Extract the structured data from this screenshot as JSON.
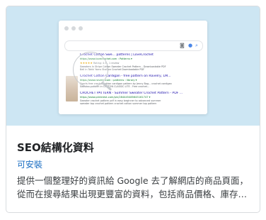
{
  "card": {
    "title": "SEO結構化資料",
    "tag": "可安裝",
    "description": "提供一個整理好的資訊給 Google 去了解網店的商品頁面，從而在搜尋結果出現更豐富的資料，包括商品價格、庫存狀態和評價等。"
  },
  "illustration": {
    "icons": {
      "camera": "camera-icon",
      "mic": "microphone-icon",
      "search": "search-icon"
    },
    "results": [
      {
        "title": "Crochet Cotton Swe... patterns | LoveCrochet",
        "url": "https://www.lovecrochet.com › Patterns ▾",
        "stars": "★★★★★",
        "meta": "Rating: 4.5 - 1 review",
        "snippet_1": "Sweaters In Stripe Cotton Sweater Crochet Pattern – Downloadable PDF",
        "snippet_2": "Bell in Tahki Yarns Stallion Crochet Downloadable PDF"
      },
      {
        "title": "Crochet Cotton Cardigan - free pattern on Ravelry, LM...",
        "url": "https://www.ravelry.com › patterns › library ▾",
        "snippet_1": "Sports free crochet cotton cardigan pattern by Jenny Bog... crochet cardigan",
        "snippet_2": "Sweater pattern in COTTON CLASSIC LITE - Free crochet..."
      },
      {
        "title": "CROCHET PATTERN - Summer Sweater Crochet Pattern - PDF ...",
        "url": "https://www.pinterest.com/pin/284445485645161747 ▾",
        "snippet_1": "Sweater crochet pattern pdf in easy beginner to advanced summer",
        "snippet_2": "sweater top crochet pattern crochet cotton summer top pattern"
      }
    ]
  },
  "colors": {
    "hero_bg": "#cde6f3",
    "link_blue": "#1a0dab",
    "tag_blue": "#1b6ec2",
    "url_green": "#0f7b2e",
    "star_gold": "#e7a80b"
  }
}
